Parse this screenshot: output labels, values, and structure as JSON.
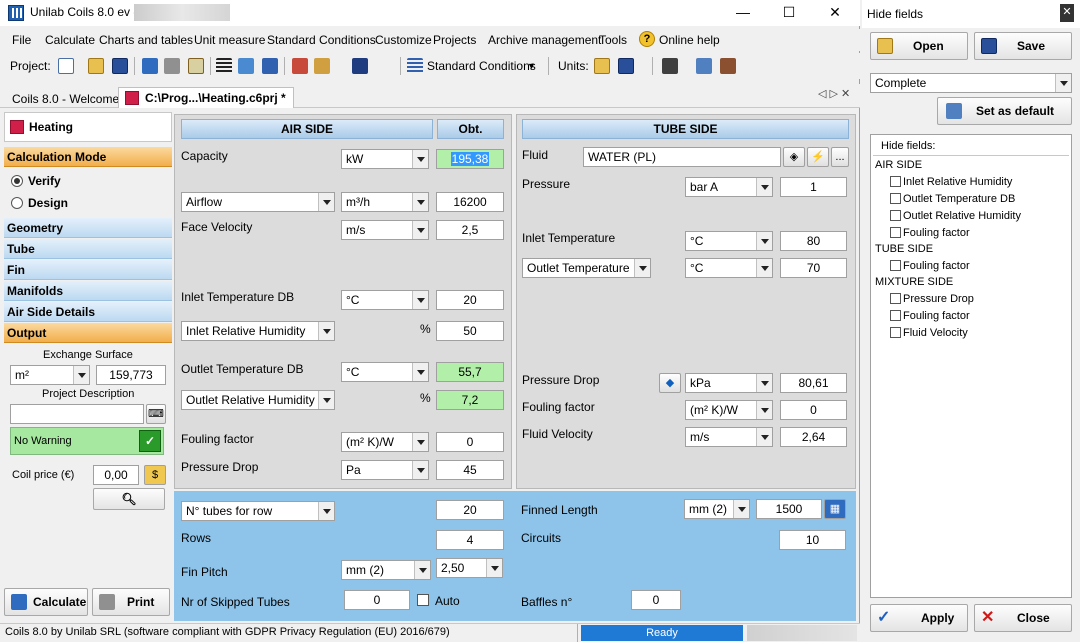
{
  "window": {
    "title": "Unilab Coils 8.0 ev -",
    "minimize": "—",
    "maximize": "☐",
    "close": "✕"
  },
  "menu": [
    "File",
    "Calculate",
    "Charts and tables",
    "Unit measure",
    "Standard Conditions",
    "Customize",
    "Projects",
    "Archive management",
    "Tools",
    "Online help"
  ],
  "toolbar": {
    "project_label": "Project:",
    "std_conditions": "Standard Conditions",
    "units_label": "Units:"
  },
  "tabs": {
    "welcome": "Coils 8.0 - Welcome!",
    "file": "C:\\Prog...\\Heating.c6prj *",
    "nav": "◁ ▷ ✕"
  },
  "left": {
    "heading": "Heating",
    "calc_mode": "Calculation Mode",
    "verify": "Verify",
    "design": "Design",
    "sections": [
      "Geometry",
      "Tube",
      "Fin",
      "Manifolds",
      "Air Side Details"
    ],
    "output": "Output",
    "exchange_surface_label": "Exchange Surface",
    "exchange_unit": "m²",
    "exchange_value": "159,773",
    "project_desc_label": "Project Description",
    "project_desc_value": "",
    "warning": "No Warning",
    "coil_price_label": "Coil price (€)",
    "coil_price_value": "0,00",
    "calculate": "Calculate",
    "print": "Print"
  },
  "air": {
    "header": "AIR SIDE",
    "obt": "Obt.",
    "capacity_label": "Capacity",
    "capacity_unit": "kW",
    "capacity_value": "195,38",
    "airflow_select": "Airflow",
    "airflow_unit": "m³/h",
    "airflow_value": "16200",
    "face_velocity_label": "Face Velocity",
    "face_velocity_unit": "m/s",
    "face_velocity_value": "2,5",
    "inlet_temp_label": "Inlet Temperature DB",
    "inlet_temp_unit": "°C",
    "inlet_temp_value": "20",
    "inlet_rh_select": "Inlet Relative Humidity",
    "inlet_rh_unit": "%",
    "inlet_rh_value": "50",
    "outlet_temp_label": "Outlet Temperature DB",
    "outlet_temp_unit": "°C",
    "outlet_temp_value": "55,7",
    "outlet_rh_select": "Outlet Relative Humidity",
    "outlet_rh_unit": "%",
    "outlet_rh_value": "7,2",
    "fouling_label": "Fouling factor",
    "fouling_unit": "(m² K)/W",
    "fouling_value": "0",
    "pdrop_label": "Pressure Drop",
    "pdrop_unit": "Pa",
    "pdrop_value": "45"
  },
  "tube": {
    "header": "TUBE SIDE",
    "fluid_label": "Fluid",
    "fluid_value": "WATER (PL)",
    "pressure_label": "Pressure",
    "pressure_unit": "bar A",
    "pressure_value": "1",
    "inlet_temp_label": "Inlet Temperature",
    "inlet_temp_unit": "°C",
    "inlet_temp_value": "80",
    "outlet_temp_select": "Outlet Temperature",
    "outlet_temp_unit": "°C",
    "outlet_temp_value": "70",
    "pdrop_label": "Pressure Drop",
    "pdrop_unit": "kPa",
    "pdrop_value": "80,61",
    "fouling_label": "Fouling factor",
    "fouling_unit": "(m² K)/W",
    "fouling_value": "0",
    "velocity_label": "Fluid Velocity",
    "velocity_unit": "m/s",
    "velocity_value": "2,64",
    "dots": "..."
  },
  "geometry": {
    "tubes_select": "N° tubes for row",
    "tubes_value": "20",
    "rows_label": "Rows",
    "rows_value": "4",
    "fin_pitch_label": "Fin Pitch",
    "fin_pitch_unit": "mm (2)",
    "fin_pitch_value": "2,50",
    "skipped_label": "Nr of Skipped Tubes",
    "skipped_value": "0",
    "auto_label": "Auto",
    "finned_length_label": "Finned Length",
    "finned_length_unit": "mm (2)",
    "finned_length_value": "1500",
    "circuits_label": "Circuits",
    "circuits_value": "10",
    "baffles_label": "Baffles n°",
    "baffles_value": "0"
  },
  "status": {
    "text": "Coils 8.0 by Unilab SRL (software compliant with GDPR Privacy Regulation (EU) 2016/679)",
    "ready": "Ready"
  },
  "hide_panel": {
    "title": "Hide fields",
    "open": "Open",
    "save": "Save",
    "preset": "Complete",
    "set_default": "Set as default",
    "hide_fields_label": "Hide fields:",
    "groups": [
      {
        "name": "AIR SIDE",
        "items": [
          "Inlet Relative Humidity",
          "Outlet Temperature DB",
          "Outlet Relative Humidity",
          "Fouling factor"
        ]
      },
      {
        "name": "TUBE SIDE",
        "items": [
          "Fouling factor"
        ]
      },
      {
        "name": "MIXTURE SIDE",
        "items": [
          "Pressure Drop",
          "Fouling factor",
          "Fluid Velocity"
        ]
      }
    ],
    "apply": "Apply",
    "close": "Close"
  },
  "colors": {
    "green_result": "#b2efa8",
    "blue_panel": "#8fc4ea",
    "orange_section": "#f2ae4b",
    "ready_bar": "#1f7ad6"
  }
}
